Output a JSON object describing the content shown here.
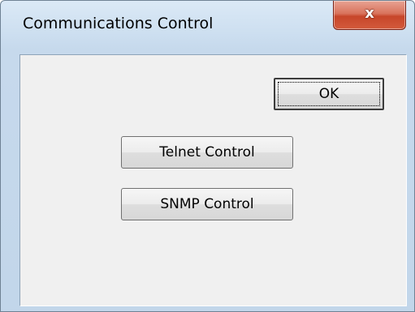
{
  "window": {
    "title": "Communications Control",
    "close_icon": "close-icon",
    "close_glyph": "x"
  },
  "buttons": {
    "ok_label": "OK",
    "telnet_label": "Telnet Control",
    "snmp_label": "SNMP Control"
  }
}
